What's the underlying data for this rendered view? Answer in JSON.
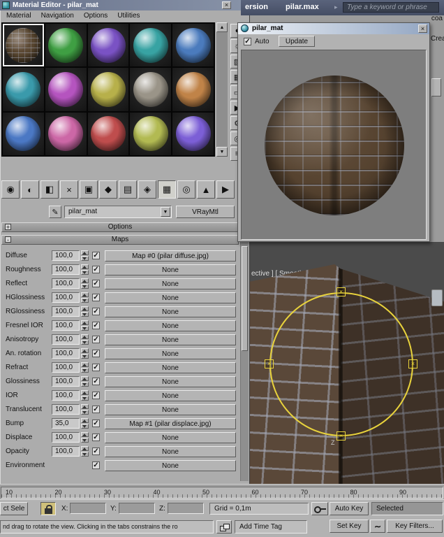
{
  "glyphs": {
    "check": "✓",
    "close": "×",
    "dropdown": "▼",
    "up_arrow": "▲",
    "down_arrow": "▼",
    "chevron": "▸",
    "plus": "+",
    "minus": "-",
    "wave": "∼"
  },
  "material_editor": {
    "title": "Material Editor - pilar_mat",
    "menus": [
      "Material",
      "Navigation",
      "Options",
      "Utilities"
    ],
    "slots": [
      {
        "type": "brick",
        "name": "pilar_mat",
        "selected": true
      },
      {
        "type": "plain",
        "color": "#3f9f43"
      },
      {
        "type": "plain",
        "color": "#7a52c4"
      },
      {
        "type": "plain",
        "color": "#38a3a3"
      },
      {
        "type": "plain",
        "color": "#4b7bbd"
      },
      {
        "type": "plain",
        "color": "#3a9aab"
      },
      {
        "type": "plain",
        "color": "#b554bf"
      },
      {
        "type": "plain",
        "color": "#b7b04a"
      },
      {
        "type": "plain",
        "color": "#9a9488"
      },
      {
        "type": "plain",
        "color": "#c08348"
      },
      {
        "type": "plain",
        "color": "#4b78c4"
      },
      {
        "type": "plain",
        "color": "#cc67a6"
      },
      {
        "type": "plain",
        "color": "#bf4d4d"
      },
      {
        "type": "plain",
        "color": "#b2ba52"
      },
      {
        "type": "plain",
        "color": "#7c5fd6"
      }
    ],
    "toolbar": [
      {
        "name": "get-material-icon",
        "glyph": "◉"
      },
      {
        "name": "put-material-to-scene-icon",
        "glyph": "◐"
      },
      {
        "name": "assign-material-to-selection-icon",
        "glyph": "◧"
      },
      {
        "name": "reset-map-icon",
        "glyph": "×"
      },
      {
        "name": "make-material-copy-icon",
        "glyph": "▣"
      },
      {
        "name": "make-unique-icon",
        "glyph": "◆"
      },
      {
        "name": "put-to-library-icon",
        "glyph": "▤"
      },
      {
        "name": "material-id-channel-icon",
        "glyph": "◈"
      },
      {
        "name": "show-map-in-viewport-icon",
        "glyph": "▦",
        "pressed": true
      },
      {
        "name": "show-end-result-icon",
        "glyph": "◎"
      },
      {
        "name": "go-to-parent-icon",
        "glyph": "▲"
      },
      {
        "name": "go-forward-to-sibling-icon",
        "glyph": "▶"
      }
    ],
    "vtoolbar": [
      {
        "name": "sample-type-icon",
        "glyph": "●"
      },
      {
        "name": "backlight-icon",
        "glyph": "☼"
      },
      {
        "name": "background-icon",
        "glyph": "▨"
      },
      {
        "name": "sample-uv-tiling-icon",
        "glyph": "▦"
      },
      {
        "name": "video-color-check-icon",
        "glyph": "▭"
      },
      {
        "name": "make-preview-icon",
        "glyph": "▶"
      },
      {
        "name": "options-icon",
        "glyph": "⚙"
      },
      {
        "name": "select-by-material-icon",
        "glyph": "◎"
      },
      {
        "name": "material-map-navigator-icon",
        "glyph": "≡"
      }
    ],
    "picker_icon": "✎",
    "material_name": "pilar_mat",
    "material_type": "VRayMtl",
    "rollout_options": "Options",
    "rollout_maps": "Maps",
    "maps": [
      {
        "label": "Diffuse",
        "amount": "100,0",
        "checked": true,
        "map": "Map #0 (pilar diffuse.jpg)"
      },
      {
        "label": "Roughness",
        "amount": "100,0",
        "checked": true,
        "map": "None"
      },
      {
        "label": "Reflect",
        "amount": "100,0",
        "checked": true,
        "map": "None"
      },
      {
        "label": "HGlossiness",
        "amount": "100,0",
        "checked": true,
        "map": "None"
      },
      {
        "label": "RGlossiness",
        "amount": "100,0",
        "checked": true,
        "map": "None"
      },
      {
        "label": "Fresnel IOR",
        "amount": "100,0",
        "checked": true,
        "map": "None"
      },
      {
        "label": "Anisotropy",
        "amount": "100,0",
        "checked": true,
        "map": "None"
      },
      {
        "label": "An. rotation",
        "amount": "100,0",
        "checked": true,
        "map": "None"
      },
      {
        "label": "Refract",
        "amount": "100,0",
        "checked": true,
        "map": "None"
      },
      {
        "label": "Glossiness",
        "amount": "100,0",
        "checked": true,
        "map": "None"
      },
      {
        "label": "IOR",
        "amount": "100,0",
        "checked": true,
        "map": "None"
      },
      {
        "label": "Translucent",
        "amount": "100,0",
        "checked": true,
        "map": "None"
      },
      {
        "label": "Bump",
        "amount": "35,0",
        "checked": true,
        "map": "Map #1 (pilar displace.jpg)"
      },
      {
        "label": "Displace",
        "amount": "100,0",
        "checked": true,
        "map": "None"
      },
      {
        "label": "Opacity",
        "amount": "100,0",
        "checked": true,
        "map": "None"
      },
      {
        "label": "Environment",
        "amount": null,
        "checked": true,
        "map": "None"
      }
    ]
  },
  "app": {
    "title_fragment": "ersion",
    "document": "pilar.max",
    "search_placeholder": "Type a keyword or phrase",
    "fragment_top_right": "coa",
    "fragment_panel": "Crea"
  },
  "preview": {
    "title": "pilar_mat",
    "auto_label": "Auto",
    "auto_checked": true,
    "update_label": "Update"
  },
  "viewport": {
    "label": "ective ] [ Smooth + Highlights ]",
    "axis_label": "Z"
  },
  "timeline": {
    "ticks": [
      "10",
      "20",
      "30",
      "40",
      "50",
      "60",
      "70",
      "80",
      "90"
    ]
  },
  "status": {
    "left_fragment": "ct Sele",
    "x_label": "X:",
    "y_label": "Y:",
    "z_label": "Z:",
    "grid_label": "Grid = 0,1m",
    "auto_key": "Auto Key",
    "set_key": "Set Key",
    "selected_set": "Selected",
    "key_filters": "Key Filters...",
    "add_time_tag": "Add Time Tag",
    "prompt": "nd drag to rotate the view. Clicking in the tabs constrains the ro"
  }
}
